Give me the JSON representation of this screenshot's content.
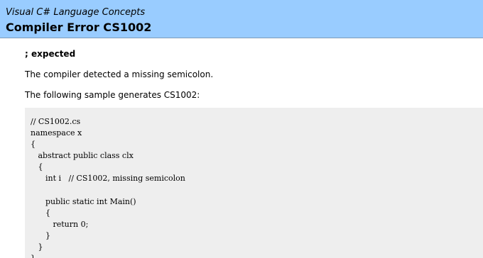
{
  "banner": {
    "subtitle": "Visual C# Language Concepts",
    "title": "Compiler Error CS1002"
  },
  "content": {
    "heading": "; expected",
    "paragraph_1": "The compiler detected a missing semicolon.",
    "paragraph_2": "The following sample generates CS1002:",
    "code": "// CS1002.cs\nnamespace x\n{\n   abstract public class clx\n   {\n      int i   // CS1002, missing semicolon\n\n      public static int Main()\n      {\n         return 0;\n      }\n   }\n}"
  },
  "colors": {
    "banner_background": "#99ccff",
    "code_background": "#eeeeee"
  }
}
